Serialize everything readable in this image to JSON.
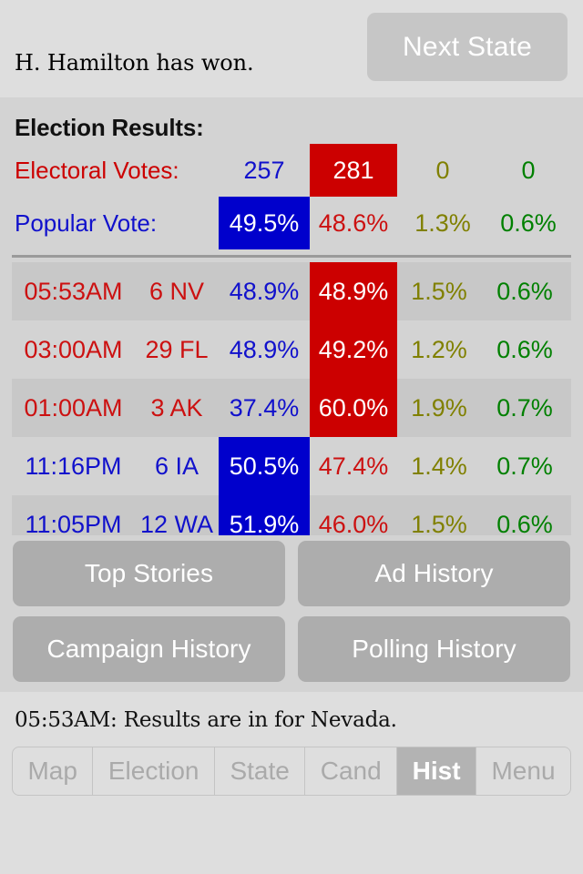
{
  "header": {
    "win_message": "H. Hamilton has won.",
    "next_state_label": "Next State"
  },
  "results": {
    "title": "Election Results:",
    "electoral": {
      "label": "Electoral Votes:",
      "c1": "257",
      "c2": "281",
      "c3": "0",
      "c4": "0",
      "leader": "c2"
    },
    "popular": {
      "label": "Popular Vote:",
      "c1": "49.5%",
      "c2": "48.6%",
      "c3": "1.3%",
      "c4": "0.6%",
      "leader": "c1"
    }
  },
  "history_rows": [
    {
      "time": "05:53AM",
      "state": "6 NV",
      "v1": "48.9%",
      "v2": "48.9%",
      "v3": "1.5%",
      "v4": "0.6%",
      "winner": "rep",
      "shaded": true
    },
    {
      "time": "03:00AM",
      "state": "29 FL",
      "v1": "48.9%",
      "v2": "49.2%",
      "v3": "1.2%",
      "v4": "0.6%",
      "winner": "rep",
      "shaded": false
    },
    {
      "time": "01:00AM",
      "state": "3 AK",
      "v1": "37.4%",
      "v2": "60.0%",
      "v3": "1.9%",
      "v4": "0.7%",
      "winner": "rep",
      "shaded": true
    },
    {
      "time": "11:16PM",
      "state": "6 IA",
      "v1": "50.5%",
      "v2": "47.4%",
      "v3": "1.4%",
      "v4": "0.7%",
      "winner": "dem",
      "shaded": false
    },
    {
      "time": "11:05PM",
      "state": "12 WA",
      "v1": "51.9%",
      "v2": "46.0%",
      "v3": "1.5%",
      "v4": "0.6%",
      "winner": "dem",
      "shaded": true
    }
  ],
  "actions": {
    "top_stories": "Top Stories",
    "ad_history": "Ad History",
    "campaign_history": "Campaign History",
    "polling_history": "Polling History"
  },
  "status": {
    "line": "05:53AM: Results are in for Nevada."
  },
  "tabs": [
    {
      "label": "Map",
      "active": false
    },
    {
      "label": "Election",
      "active": false
    },
    {
      "label": "State",
      "active": false
    },
    {
      "label": "Cand",
      "active": false
    },
    {
      "label": "Hist",
      "active": true
    },
    {
      "label": "Menu",
      "active": false
    }
  ],
  "colors": {
    "democrat": "#1111cc",
    "republican": "#cc1111",
    "third": "#808000",
    "fourth": "#008000",
    "highlight_blue": "#0000cc",
    "highlight_red": "#cc0000",
    "page_bg": "#d3d3d3",
    "bar_bg": "#dedede",
    "button_bg": "#adadad"
  }
}
